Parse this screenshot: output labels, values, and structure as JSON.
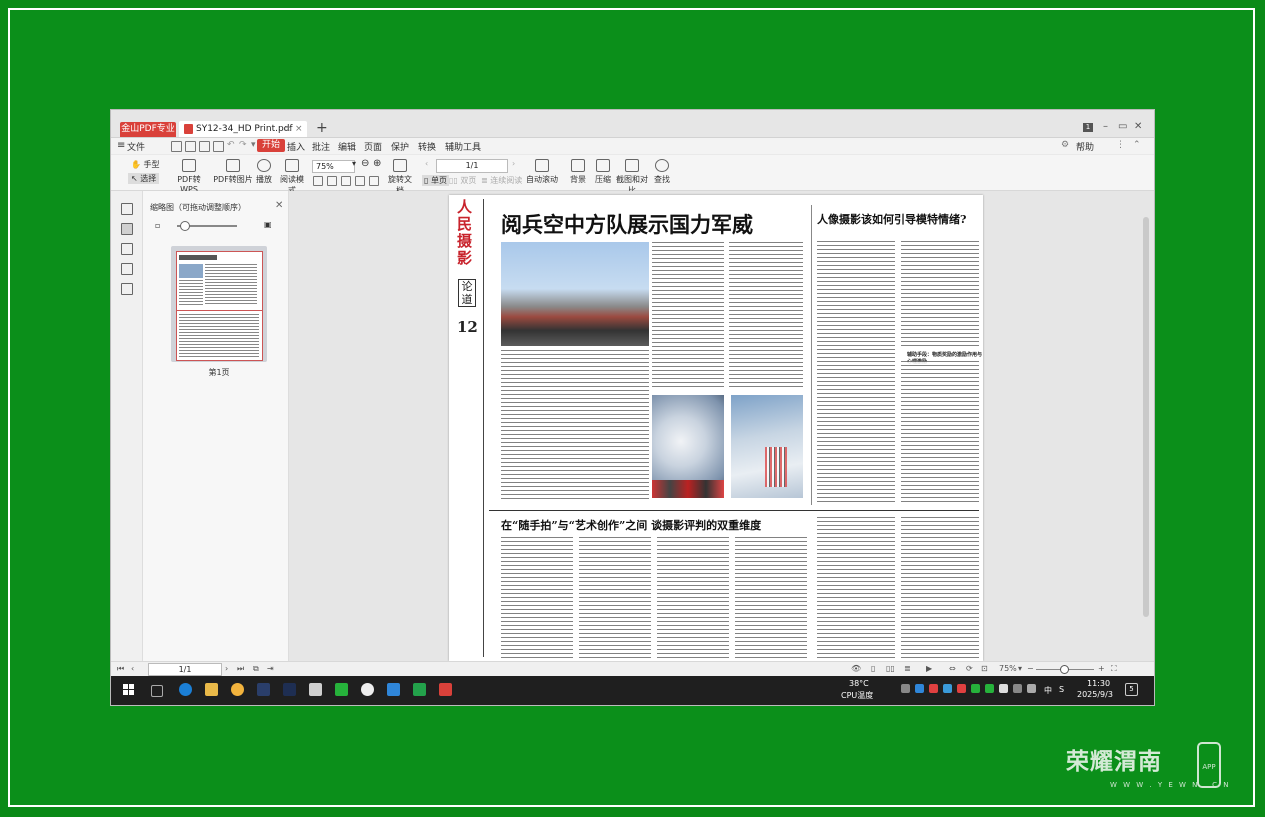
{
  "app": {
    "app_tab": "金山PDF专业版",
    "doc_tab": "SY12-34_HD Print.pdf",
    "new_tab": "+"
  },
  "menu": {
    "file": "文件",
    "items": [
      "开始",
      "插入",
      "批注",
      "编辑",
      "页面",
      "保护",
      "转换",
      "辅助工具"
    ],
    "help": "帮助"
  },
  "toolbar": {
    "hand": "手型",
    "select": "选择",
    "pdf_to_wps": "PDF转WPS",
    "pdf_to_image": "PDF转图片",
    "play": "播放",
    "read_mode": "阅读模式",
    "zoom": "75%",
    "rotate": "旋转文档",
    "single_page": "单页",
    "double_page": "双页",
    "continuous": "连续阅读",
    "auto_scroll": "自动滚动",
    "background": "背景",
    "compress": "压缩",
    "screenshot": "截图和对比",
    "find": "查找",
    "page_field": "1/1"
  },
  "thumbnails": {
    "title": "缩略图（可拖动调整顺序）",
    "page_label": "第1页"
  },
  "newspaper": {
    "masthead": "人民摄影",
    "section": "论道",
    "issue": "12",
    "headline": "阅兵空中方队展示国力军威",
    "headline2": "在“随手拍”与“艺术创作”之间  谈摄影评判的双重维度",
    "headline3": "人像摄影该如何引导模特情绪?",
    "sub1": "辅助手段：物质奖励的激励作用与心理激励"
  },
  "status": {
    "page_field": "1/1",
    "zoom": "75%"
  },
  "taskbar": {
    "temp": "38°C",
    "cpu": "CPU温度",
    "ime1": "中",
    "ime2": "S",
    "time": "11:30",
    "date": "2025/9/3"
  },
  "watermark": {
    "brand": "荣耀渭南",
    "url": "W W W . Y E W N . C N",
    "app": "APP"
  }
}
